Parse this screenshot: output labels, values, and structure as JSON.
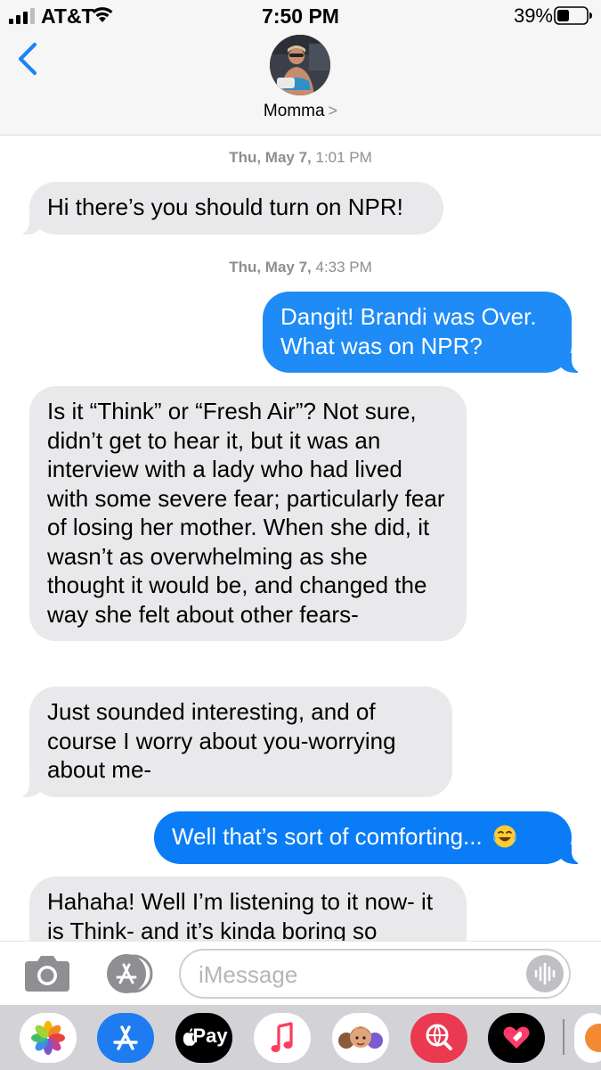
{
  "status_bar": {
    "carrier": "AT&T",
    "time": "7:50 PM",
    "battery_percent": "39%"
  },
  "header": {
    "contact_name": "Momma",
    "contact_chevron": ">"
  },
  "conversation": {
    "timestamp_1": {
      "day": "Thu, May 7,",
      "time": " 1:01 PM"
    },
    "msg_1": "Hi there’s you should turn on NPR!",
    "timestamp_2": {
      "day": "Thu, May 7,",
      "time": " 4:33 PM"
    },
    "msg_2": "Dangit! Brandi was Over. What was on NPR?",
    "msg_3": "Is it “Think” or “Fresh Air”? Not sure, didn’t get to hear it, but it was an interview with a lady who had lived with some severe fear; particularly fear of losing her mother. When she did, it wasn’t as overwhelming as she thought it would be, and changed the way she felt about other fears-",
    "msg_4": "Just sounded interesting, and of course I worry about you-worrying about me-",
    "msg_5": "Well that’s sort of comforting...",
    "msg_5_emoji": "face-with-tears-of-joy",
    "msg_6": "Hahaha! Well I’m listening to it now- it is Think- and it’s kinda boring so"
  },
  "input": {
    "placeholder": "iMessage"
  },
  "app_drawer": {
    "apps": [
      "photos",
      "app-store",
      "apple-pay",
      "music",
      "memoji",
      "web-search",
      "digital-touch"
    ],
    "apple_pay_label": "Pay"
  },
  "colors": {
    "sent_bubble": "#1e8bf6",
    "received_bubble": "#e9e9eb",
    "accent": "#0a7aff"
  }
}
